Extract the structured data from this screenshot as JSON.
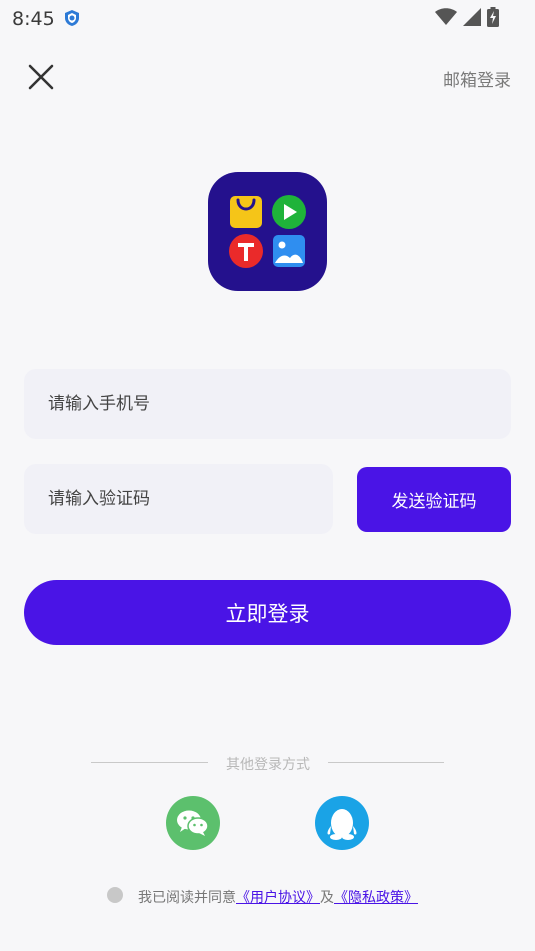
{
  "status": {
    "time": "8:45",
    "icons": [
      "vpn-icon",
      "wifi-icon",
      "signal-icon",
      "battery-charging-icon"
    ]
  },
  "topbar": {
    "close_icon": "close-icon",
    "email_login": "邮箱登录"
  },
  "app_icon": {
    "tiles": [
      "shopping-bag-icon",
      "play-icon",
      "text-t-icon",
      "image-icon"
    ]
  },
  "form": {
    "phone_placeholder": "请输入手机号",
    "code_placeholder": "请输入验证码",
    "send_code": "发送验证码",
    "login": "立即登录"
  },
  "other_login": {
    "label": "其他登录方式",
    "options": [
      "wechat-icon",
      "qq-icon"
    ]
  },
  "agreement": {
    "prefix": "我已阅读并同意",
    "user_agreement": "《用户协议》",
    "and": "及",
    "privacy_policy": "《隐私政策》"
  },
  "colors": {
    "accent": "#4a14e6",
    "icon_bg": "#24118d",
    "wechat": "#5cc06d",
    "qq": "#1aa3e6"
  }
}
